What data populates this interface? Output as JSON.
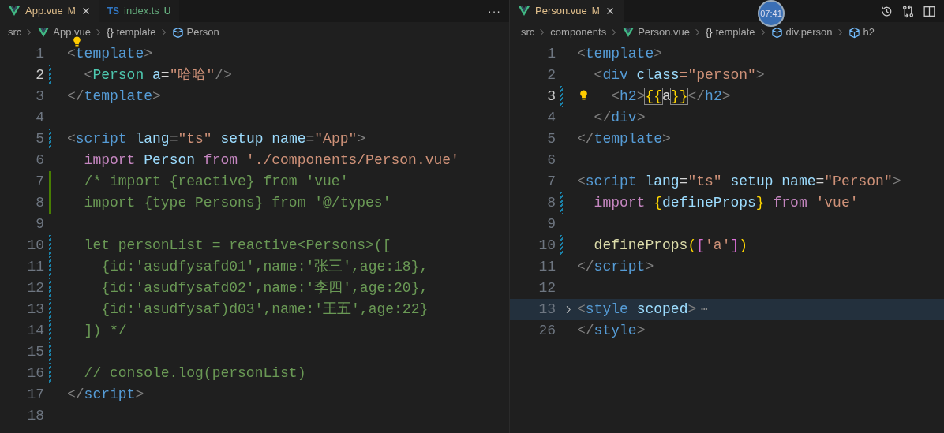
{
  "recorder_badge": "07:41",
  "panes": [
    {
      "tabs": [
        {
          "label": "App.vue",
          "badge": "M",
          "kind": "vue",
          "untracked": false,
          "selected": true
        },
        {
          "label": "index.ts",
          "badge": "U",
          "kind": "ts",
          "icon_text": "TS",
          "untracked": true,
          "selected": false
        }
      ],
      "more": "···",
      "breadcrumbs": [
        {
          "text": "src"
        },
        {
          "text": "App.vue",
          "kind": "vue"
        },
        {
          "text": "template",
          "glyph": "{}"
        },
        {
          "text": "Person",
          "kind": "cube"
        }
      ],
      "lines": [
        {
          "n": "1",
          "current": false,
          "modified": false,
          "added": false,
          "bulb": true,
          "tokens": [
            {
              "t": "<",
              "kind": "punct"
            },
            {
              "t": "template",
              "kind": "tag"
            },
            {
              "t": ">",
              "kind": "punct"
            }
          ]
        },
        {
          "n": "2",
          "current": true,
          "modified": true,
          "added": false,
          "tokens": [
            {
              "t": "  <",
              "kind": "punct"
            },
            {
              "t": "Person",
              "kind": "component"
            },
            {
              "t": " a",
              "kind": "attr"
            },
            {
              "t": "=",
              "kind": "text"
            },
            {
              "t": "\"哈哈\"",
              "kind": "str"
            },
            {
              "t": "/>",
              "kind": "punct"
            }
          ]
        },
        {
          "n": "3",
          "current": false,
          "modified": false,
          "added": false,
          "tokens": [
            {
              "t": "</",
              "kind": "punct"
            },
            {
              "t": "template",
              "kind": "tag"
            },
            {
              "t": ">",
              "kind": "punct"
            }
          ]
        },
        {
          "n": "4",
          "current": false,
          "modified": false,
          "added": false
        },
        {
          "n": "5",
          "current": false,
          "modified": true,
          "added": false,
          "tokens": [
            {
              "t": "<",
              "kind": "punct"
            },
            {
              "t": "script",
              "kind": "tag"
            },
            {
              "t": " lang",
              "kind": "attr"
            },
            {
              "t": "=",
              "kind": "text"
            },
            {
              "t": "\"ts\"",
              "kind": "str"
            },
            {
              "t": " setup name",
              "kind": "attr"
            },
            {
              "t": "=",
              "kind": "text"
            },
            {
              "t": "\"App\"",
              "kind": "str"
            },
            {
              "t": ">",
              "kind": "punct"
            }
          ]
        },
        {
          "n": "6",
          "current": false,
          "modified": false,
          "added": false,
          "tokens": [
            {
              "t": "  import",
              "kind": "kw"
            },
            {
              "t": " Person ",
              "kind": "ident"
            },
            {
              "t": "from",
              "kind": "kw"
            },
            {
              "t": " './components/Person.vue'",
              "kind": "str"
            }
          ]
        },
        {
          "n": "7",
          "current": false,
          "modified": false,
          "added": true,
          "tokens": [
            {
              "t": "  /* import {reactive} from 'vue'",
              "kind": "comment"
            }
          ]
        },
        {
          "n": "8",
          "current": false,
          "modified": false,
          "added": true,
          "tokens": [
            {
              "t": "  import {type Persons} from '@/types'",
              "kind": "comment"
            }
          ]
        },
        {
          "n": "9",
          "current": false,
          "modified": false,
          "added": false
        },
        {
          "n": "10",
          "current": false,
          "modified": true,
          "added": false,
          "tokens": [
            {
              "t": "  let personList = reactive<Persons>([",
              "kind": "comment"
            }
          ]
        },
        {
          "n": "11",
          "current": false,
          "modified": true,
          "added": false,
          "tokens": [
            {
              "t": "    {id:'asudfysafd01',name:'张三',age:18},",
              "kind": "comment"
            }
          ]
        },
        {
          "n": "12",
          "current": false,
          "modified": true,
          "added": false,
          "tokens": [
            {
              "t": "    {id:'asudfysafd02',name:'李四',age:20},",
              "kind": "comment"
            }
          ]
        },
        {
          "n": "13",
          "current": false,
          "modified": true,
          "added": false,
          "tokens": [
            {
              "t": "    {id:'asudfysaf)d03',name:'王五',age:22}",
              "kind": "comment"
            }
          ]
        },
        {
          "n": "14",
          "current": false,
          "modified": true,
          "added": false,
          "tokens": [
            {
              "t": "  ]) */",
              "kind": "comment"
            }
          ]
        },
        {
          "n": "15",
          "current": false,
          "modified": true,
          "added": false
        },
        {
          "n": "16",
          "current": false,
          "modified": true,
          "added": false,
          "tokens": [
            {
              "t": "  // console.log(personList)",
              "kind": "comment"
            }
          ]
        },
        {
          "n": "17",
          "current": false,
          "modified": false,
          "added": false,
          "tokens": [
            {
              "t": "</",
              "kind": "punct"
            },
            {
              "t": "script",
              "kind": "tag"
            },
            {
              "t": ">",
              "kind": "punct"
            }
          ]
        },
        {
          "n": "18",
          "current": false,
          "modified": false,
          "added": false
        }
      ]
    },
    {
      "tabs": [
        {
          "label": "Person.vue",
          "badge": "M",
          "kind": "vue",
          "untracked": false,
          "selected": true
        }
      ],
      "actions": [
        {
          "kind": "history"
        },
        {
          "kind": "compare"
        },
        {
          "kind": "split"
        }
      ],
      "breadcrumbs": [
        {
          "text": "src"
        },
        {
          "text": "components"
        },
        {
          "text": "Person.vue",
          "kind": "vue"
        },
        {
          "text": "template",
          "glyph": "{}"
        },
        {
          "text": "div.person",
          "kind": "cube"
        },
        {
          "text": "h2",
          "kind": "cube"
        }
      ],
      "lines": [
        {
          "n": "1",
          "current": false,
          "modified": false,
          "added": false,
          "tokens": [
            {
              "t": "<",
              "kind": "punct"
            },
            {
              "t": "template",
              "kind": "tag"
            },
            {
              "t": ">",
              "kind": "punct"
            }
          ]
        },
        {
          "n": "2",
          "current": false,
          "modified": false,
          "added": false,
          "tokens": [
            {
              "t": "  <",
              "kind": "punct"
            },
            {
              "t": "div",
              "kind": "tag"
            },
            {
              "t": " class",
              "kind": "attr"
            },
            {
              "t": "=\"",
              "kind": "str"
            },
            {
              "t": "person",
              "kind": "strline"
            },
            {
              "t": "\"",
              "kind": "str"
            },
            {
              "t": ">",
              "kind": "punct"
            }
          ]
        },
        {
          "n": "3",
          "current": true,
          "modified": true,
          "added": false,
          "bulb": true,
          "tokens": [
            {
              "t": "    <",
              "kind": "punct"
            },
            {
              "t": "h2",
              "kind": "tag"
            },
            {
              "t": ">",
              "kind": "punct"
            },
            {
              "t": "{{",
              "kind": "match"
            },
            {
              "t": "a",
              "kind": "text"
            },
            {
              "t": "}}",
              "kind": "match"
            },
            {
              "t": "</",
              "kind": "punct"
            },
            {
              "t": "h2",
              "kind": "tag"
            },
            {
              "t": ">",
              "kind": "punct"
            }
          ]
        },
        {
          "n": "4",
          "current": false,
          "modified": false,
          "added": false,
          "tokens": [
            {
              "t": "  </",
              "kind": "punct"
            },
            {
              "t": "div",
              "kind": "tag"
            },
            {
              "t": ">",
              "kind": "punct"
            }
          ]
        },
        {
          "n": "5",
          "current": false,
          "modified": false,
          "added": false,
          "tokens": [
            {
              "t": "</",
              "kind": "punct"
            },
            {
              "t": "template",
              "kind": "tag"
            },
            {
              "t": ">",
              "kind": "punct"
            }
          ]
        },
        {
          "n": "6",
          "current": false,
          "modified": false,
          "added": false
        },
        {
          "n": "7",
          "current": false,
          "modified": false,
          "added": false,
          "tokens": [
            {
              "t": "<",
              "kind": "punct"
            },
            {
              "t": "script",
              "kind": "tag"
            },
            {
              "t": " lang",
              "kind": "attr"
            },
            {
              "t": "=",
              "kind": "text"
            },
            {
              "t": "\"ts\"",
              "kind": "str"
            },
            {
              "t": " setup name",
              "kind": "attr"
            },
            {
              "t": "=",
              "kind": "text"
            },
            {
              "t": "\"Person\"",
              "kind": "str"
            },
            {
              "t": ">",
              "kind": "punct"
            }
          ]
        },
        {
          "n": "8",
          "current": false,
          "modified": true,
          "added": false,
          "tokens": [
            {
              "t": "  import",
              "kind": "kw"
            },
            {
              "t": " {",
              "kind": "bracket"
            },
            {
              "t": "defineProps",
              "kind": "ident"
            },
            {
              "t": "}",
              "kind": "bracket"
            },
            {
              "t": " from",
              "kind": "kw"
            },
            {
              "t": " 'vue'",
              "kind": "str"
            }
          ]
        },
        {
          "n": "9",
          "current": false,
          "modified": false,
          "added": false
        },
        {
          "n": "10",
          "current": false,
          "modified": true,
          "added": false,
          "tokens": [
            {
              "t": "  defineProps",
              "kind": "func"
            },
            {
              "t": "(",
              "kind": "bracket"
            },
            {
              "t": "[",
              "kind": "bracket2"
            },
            {
              "t": "'a'",
              "kind": "str"
            },
            {
              "t": "]",
              "kind": "bracket2"
            },
            {
              "t": ")",
              "kind": "bracket"
            }
          ]
        },
        {
          "n": "11",
          "current": false,
          "modified": false,
          "added": false,
          "tokens": [
            {
              "t": "</",
              "kind": "punct"
            },
            {
              "t": "script",
              "kind": "tag"
            },
            {
              "t": ">",
              "kind": "punct"
            }
          ]
        },
        {
          "n": "12",
          "current": false,
          "modified": false,
          "added": false
        },
        {
          "n": "13",
          "current": false,
          "modified": false,
          "added": false,
          "folded": true,
          "fold_text": "⋯",
          "tokens": [
            {
              "t": "<",
              "kind": "punct"
            },
            {
              "t": "style",
              "kind": "tag"
            },
            {
              "t": " scoped",
              "kind": "attr"
            },
            {
              "t": ">",
              "kind": "punct"
            }
          ]
        },
        {
          "n": "26",
          "current": false,
          "modified": false,
          "added": false,
          "tokens": [
            {
              "t": "</",
              "kind": "punct"
            },
            {
              "t": "style",
              "kind": "tag"
            },
            {
              "t": ">",
              "kind": "punct"
            }
          ]
        }
      ]
    }
  ]
}
